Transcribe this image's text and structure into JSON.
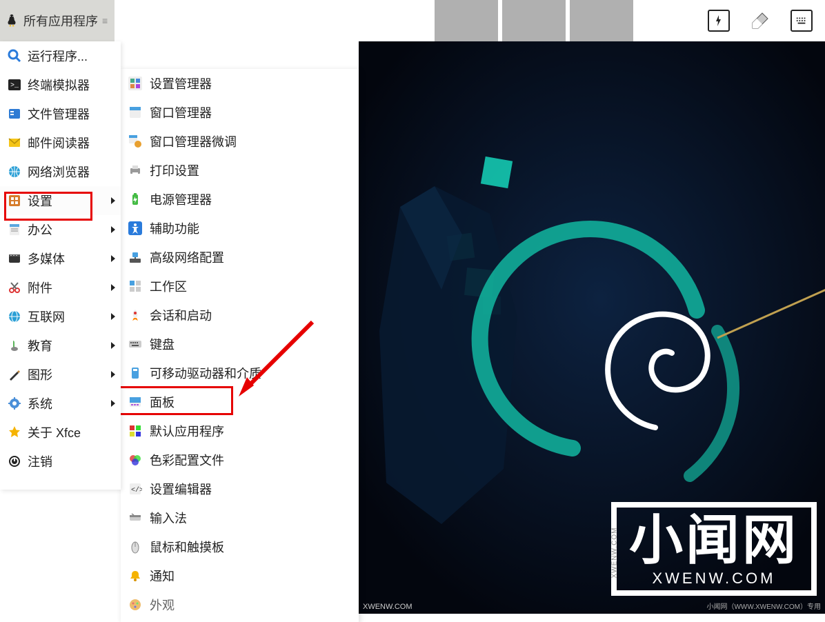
{
  "panel": {
    "all_apps": "所有应用程序"
  },
  "menu": {
    "items": [
      {
        "label": "运行程序...",
        "icon": "search"
      },
      {
        "label": "终端模拟器",
        "icon": "terminal"
      },
      {
        "label": "文件管理器",
        "icon": "files"
      },
      {
        "label": "邮件阅读器",
        "icon": "mail"
      },
      {
        "label": "网络浏览器",
        "icon": "globe"
      },
      {
        "label": "设置",
        "icon": "settings",
        "sub": true,
        "active": true,
        "highlight": true
      },
      {
        "label": "办公",
        "icon": "office",
        "sub": true
      },
      {
        "label": "多媒体",
        "icon": "media",
        "sub": true
      },
      {
        "label": "附件",
        "icon": "scissors",
        "sub": true
      },
      {
        "label": "互联网",
        "icon": "internet",
        "sub": true
      },
      {
        "label": "教育",
        "icon": "edu",
        "sub": true
      },
      {
        "label": "图形",
        "icon": "graphics",
        "sub": true
      },
      {
        "label": "系统",
        "icon": "system",
        "sub": true
      },
      {
        "label": "关于 Xfce",
        "icon": "star"
      },
      {
        "label": "注销",
        "icon": "logout"
      }
    ]
  },
  "submenu": {
    "items": [
      {
        "label": "设置管理器",
        "icon": "settings-mgr"
      },
      {
        "label": "窗口管理器",
        "icon": "wm"
      },
      {
        "label": "窗口管理器微调",
        "icon": "wm-tweak"
      },
      {
        "label": "打印设置",
        "icon": "printer"
      },
      {
        "label": "电源管理器",
        "icon": "battery"
      },
      {
        "label": "辅助功能",
        "icon": "accessibility"
      },
      {
        "label": "高级网络配置",
        "icon": "network"
      },
      {
        "label": "工作区",
        "icon": "workspace"
      },
      {
        "label": "会话和启动",
        "icon": "rocket"
      },
      {
        "label": "键盘",
        "icon": "keyboard"
      },
      {
        "label": "可移动驱动器和介质",
        "icon": "drive"
      },
      {
        "label": "面板",
        "icon": "panel",
        "highlight": true
      },
      {
        "label": "默认应用程序",
        "icon": "default-apps"
      },
      {
        "label": "色彩配置文件",
        "icon": "color"
      },
      {
        "label": "设置编辑器",
        "icon": "editor"
      },
      {
        "label": "输入法",
        "icon": "input-method"
      },
      {
        "label": "鼠标和触摸板",
        "icon": "mouse"
      },
      {
        "label": "通知",
        "icon": "bell"
      },
      {
        "label": "外观",
        "icon": "appearance"
      }
    ]
  },
  "watermark": {
    "title": "小闻网",
    "url": "XWENW.COM",
    "corner": "XWENW.COM",
    "note": "小闻网（WWW.XWENW.COM）专用"
  }
}
